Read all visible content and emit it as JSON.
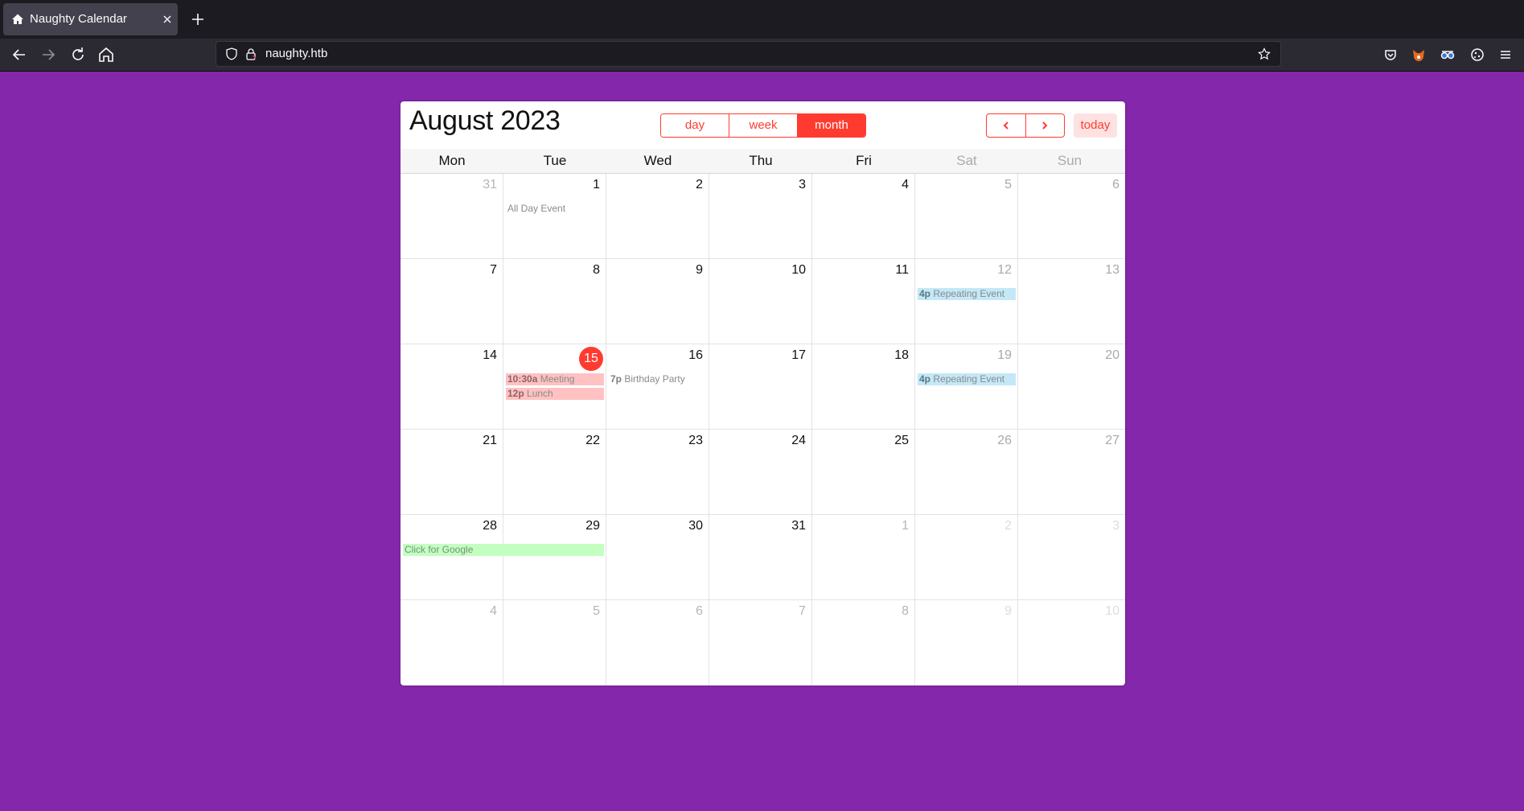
{
  "browser": {
    "tab_title": "Naughty Calendar",
    "url": "naughty.htb"
  },
  "calendar": {
    "title": "August 2023",
    "views": [
      "day",
      "week",
      "month"
    ],
    "active_view": "month",
    "today_label": "today",
    "weekdays": [
      "Mon",
      "Tue",
      "Wed",
      "Thu",
      "Fri",
      "Sat",
      "Sun"
    ],
    "weeks": [
      [
        "31",
        "1",
        "2",
        "3",
        "4",
        "5",
        "6"
      ],
      [
        "7",
        "8",
        "9",
        "10",
        "11",
        "12",
        "13"
      ],
      [
        "14",
        "15",
        "16",
        "17",
        "18",
        "19",
        "20"
      ],
      [
        "21",
        "22",
        "23",
        "24",
        "25",
        "26",
        "27"
      ],
      [
        "28",
        "29",
        "30",
        "31",
        "1",
        "2",
        "3"
      ],
      [
        "4",
        "5",
        "6",
        "7",
        "8",
        "9",
        "10"
      ]
    ],
    "today_date": "15",
    "events": {
      "all_day": {
        "label": "All Day Event"
      },
      "repeat_1": {
        "time": "4p",
        "label": "Repeating Event"
      },
      "repeat_2": {
        "time": "4p",
        "label": "Repeating Event"
      },
      "meeting": {
        "time": "10:30a",
        "label": "Meeting"
      },
      "lunch": {
        "time": "12p",
        "label": "Lunch"
      },
      "birthday": {
        "time": "7p",
        "label": "Birthday Party"
      },
      "google": {
        "label": "Click for Google"
      }
    },
    "colors": {
      "accent": "#ff3b30",
      "background": "#8427AA"
    }
  }
}
